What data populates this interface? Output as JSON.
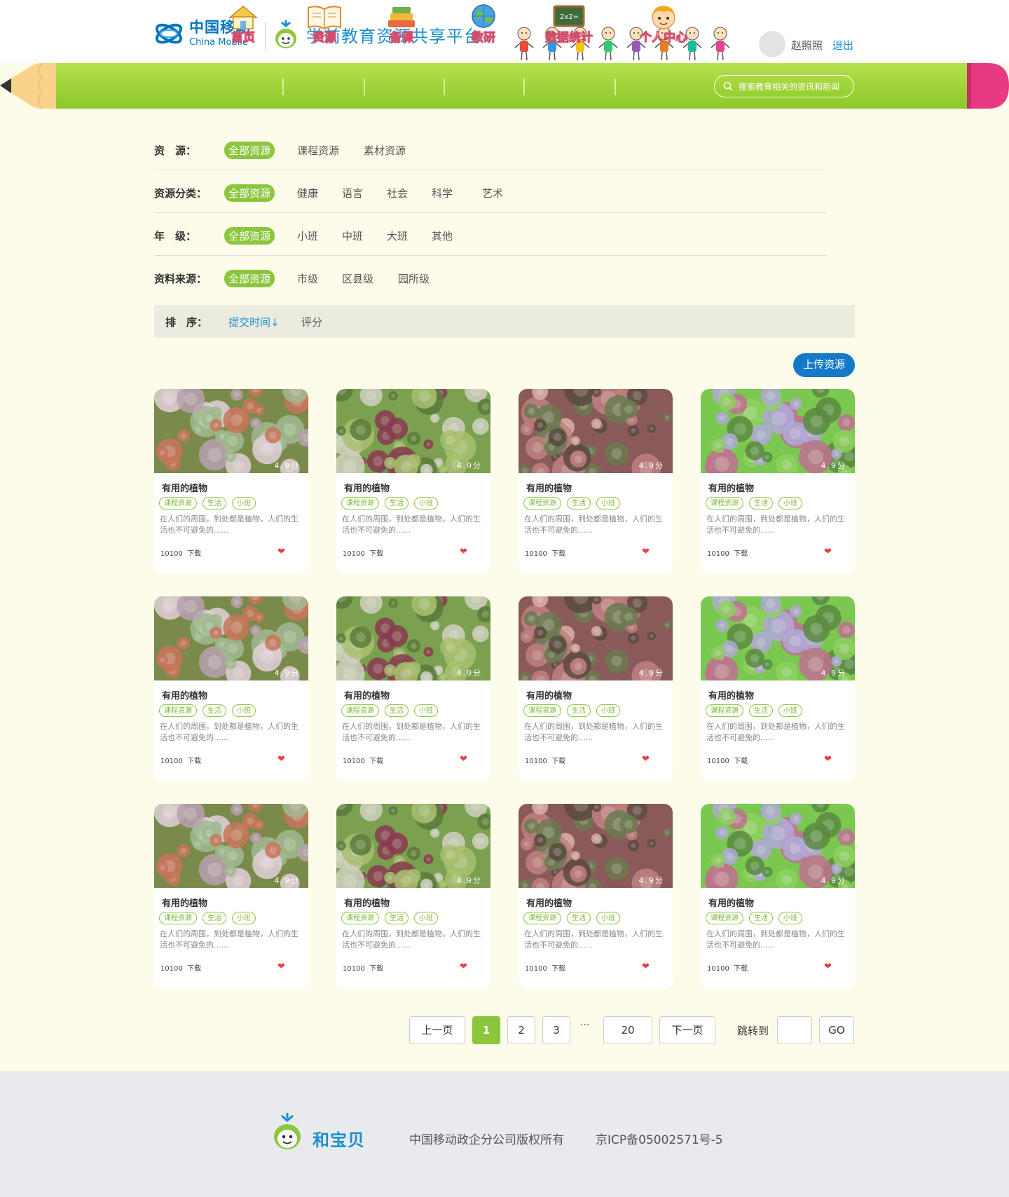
{
  "header": {
    "brand_zh": "中国移动",
    "brand_en": "China Mobile",
    "platform_title": "学前教育资源共享平台",
    "user_name": "赵照照",
    "logout": "退出"
  },
  "nav": {
    "items": [
      {
        "label": "首页",
        "icon": "house-icon"
      },
      {
        "label": "资源",
        "icon": "book-icon"
      },
      {
        "label": "备课",
        "icon": "books-stack-icon"
      },
      {
        "label": "教研",
        "icon": "globe-icon"
      },
      {
        "label": "数据统计",
        "icon": "chalkboard-icon"
      },
      {
        "label": "个人中心",
        "icon": "child-face-icon"
      }
    ],
    "search_placeholder": "搜索教育相关的资讯和新闻"
  },
  "filters": [
    {
      "label": "资　源：",
      "options": [
        "全部资源",
        "课程资源",
        "素材资源"
      ],
      "active": 0
    },
    {
      "label": "资源分类：",
      "options": [
        "全部资源",
        "健康",
        "语言",
        "社会",
        "科学",
        "艺术"
      ],
      "active": 0
    },
    {
      "label": "年　级：",
      "options": [
        "全部资源",
        "小班",
        "中班",
        "大班",
        "其他"
      ],
      "active": 0
    },
    {
      "label": "资料来源：",
      "options": [
        "全部资源",
        "市级",
        "区县级",
        "园所级"
      ],
      "active": 0
    }
  ],
  "sort": {
    "label": "排　序：",
    "time": "提交时间↓",
    "score": "评分"
  },
  "upload_label": "上传资源",
  "card_template": {
    "score": "4.9分",
    "title": "有用的植物",
    "tags": [
      "课程资源",
      "生活",
      "小班"
    ],
    "desc": "在人们的周围，到处都是植物，人们的生活也不可避免的......",
    "downloads": "10100",
    "download_label": "下载"
  },
  "pagination": {
    "prev": "上一页",
    "pages": [
      "1",
      "2",
      "3"
    ],
    "ellipsis": "···",
    "last": "20",
    "next": "下一页",
    "jump_label": "跳转到",
    "go": "GO"
  },
  "footer": {
    "brand": "和宝贝",
    "copyright": "中国移动政企分公司版权所有",
    "icp": "京ICP备05002571号-5"
  },
  "colors": {
    "accent_green": "#8cc63e",
    "nav_green": "#a7d640",
    "brand_blue": "#1a8ed1",
    "upload_blue": "#1479c9",
    "page_bg": "#fdfbea",
    "footer_bg": "#e8eaed",
    "heart_red": "#e94040"
  }
}
